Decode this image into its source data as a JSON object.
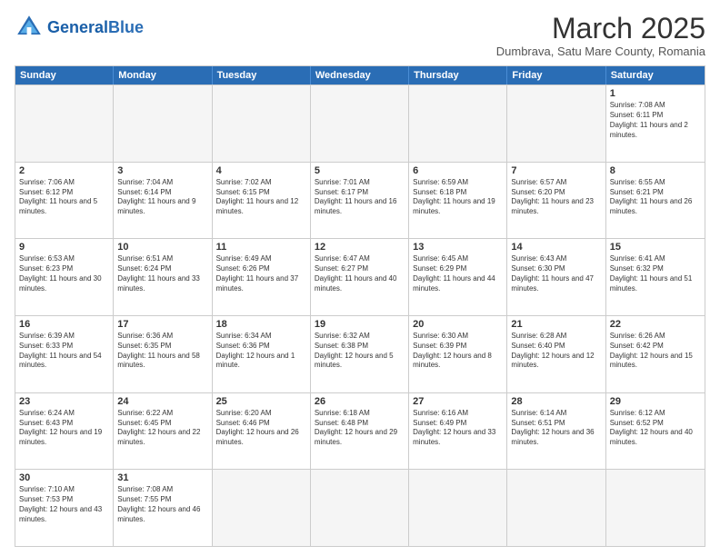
{
  "header": {
    "logo_general": "General",
    "logo_blue": "Blue",
    "month_title": "March 2025",
    "subtitle": "Dumbrava, Satu Mare County, Romania"
  },
  "days": [
    "Sunday",
    "Monday",
    "Tuesday",
    "Wednesday",
    "Thursday",
    "Friday",
    "Saturday"
  ],
  "weeks": [
    [
      {
        "num": "",
        "text": "",
        "empty": true
      },
      {
        "num": "",
        "text": "",
        "empty": true
      },
      {
        "num": "",
        "text": "",
        "empty": true
      },
      {
        "num": "",
        "text": "",
        "empty": true
      },
      {
        "num": "",
        "text": "",
        "empty": true
      },
      {
        "num": "",
        "text": "",
        "empty": true
      },
      {
        "num": "1",
        "text": "Sunrise: 7:08 AM\nSunset: 6:11 PM\nDaylight: 11 hours and 2 minutes."
      }
    ],
    [
      {
        "num": "2",
        "text": "Sunrise: 7:06 AM\nSunset: 6:12 PM\nDaylight: 11 hours and 5 minutes."
      },
      {
        "num": "3",
        "text": "Sunrise: 7:04 AM\nSunset: 6:14 PM\nDaylight: 11 hours and 9 minutes."
      },
      {
        "num": "4",
        "text": "Sunrise: 7:02 AM\nSunset: 6:15 PM\nDaylight: 11 hours and 12 minutes."
      },
      {
        "num": "5",
        "text": "Sunrise: 7:01 AM\nSunset: 6:17 PM\nDaylight: 11 hours and 16 minutes."
      },
      {
        "num": "6",
        "text": "Sunrise: 6:59 AM\nSunset: 6:18 PM\nDaylight: 11 hours and 19 minutes."
      },
      {
        "num": "7",
        "text": "Sunrise: 6:57 AM\nSunset: 6:20 PM\nDaylight: 11 hours and 23 minutes."
      },
      {
        "num": "8",
        "text": "Sunrise: 6:55 AM\nSunset: 6:21 PM\nDaylight: 11 hours and 26 minutes."
      }
    ],
    [
      {
        "num": "9",
        "text": "Sunrise: 6:53 AM\nSunset: 6:23 PM\nDaylight: 11 hours and 30 minutes."
      },
      {
        "num": "10",
        "text": "Sunrise: 6:51 AM\nSunset: 6:24 PM\nDaylight: 11 hours and 33 minutes."
      },
      {
        "num": "11",
        "text": "Sunrise: 6:49 AM\nSunset: 6:26 PM\nDaylight: 11 hours and 37 minutes."
      },
      {
        "num": "12",
        "text": "Sunrise: 6:47 AM\nSunset: 6:27 PM\nDaylight: 11 hours and 40 minutes."
      },
      {
        "num": "13",
        "text": "Sunrise: 6:45 AM\nSunset: 6:29 PM\nDaylight: 11 hours and 44 minutes."
      },
      {
        "num": "14",
        "text": "Sunrise: 6:43 AM\nSunset: 6:30 PM\nDaylight: 11 hours and 47 minutes."
      },
      {
        "num": "15",
        "text": "Sunrise: 6:41 AM\nSunset: 6:32 PM\nDaylight: 11 hours and 51 minutes."
      }
    ],
    [
      {
        "num": "16",
        "text": "Sunrise: 6:39 AM\nSunset: 6:33 PM\nDaylight: 11 hours and 54 minutes."
      },
      {
        "num": "17",
        "text": "Sunrise: 6:36 AM\nSunset: 6:35 PM\nDaylight: 11 hours and 58 minutes."
      },
      {
        "num": "18",
        "text": "Sunrise: 6:34 AM\nSunset: 6:36 PM\nDaylight: 12 hours and 1 minute."
      },
      {
        "num": "19",
        "text": "Sunrise: 6:32 AM\nSunset: 6:38 PM\nDaylight: 12 hours and 5 minutes."
      },
      {
        "num": "20",
        "text": "Sunrise: 6:30 AM\nSunset: 6:39 PM\nDaylight: 12 hours and 8 minutes."
      },
      {
        "num": "21",
        "text": "Sunrise: 6:28 AM\nSunset: 6:40 PM\nDaylight: 12 hours and 12 minutes."
      },
      {
        "num": "22",
        "text": "Sunrise: 6:26 AM\nSunset: 6:42 PM\nDaylight: 12 hours and 15 minutes."
      }
    ],
    [
      {
        "num": "23",
        "text": "Sunrise: 6:24 AM\nSunset: 6:43 PM\nDaylight: 12 hours and 19 minutes."
      },
      {
        "num": "24",
        "text": "Sunrise: 6:22 AM\nSunset: 6:45 PM\nDaylight: 12 hours and 22 minutes."
      },
      {
        "num": "25",
        "text": "Sunrise: 6:20 AM\nSunset: 6:46 PM\nDaylight: 12 hours and 26 minutes."
      },
      {
        "num": "26",
        "text": "Sunrise: 6:18 AM\nSunset: 6:48 PM\nDaylight: 12 hours and 29 minutes."
      },
      {
        "num": "27",
        "text": "Sunrise: 6:16 AM\nSunset: 6:49 PM\nDaylight: 12 hours and 33 minutes."
      },
      {
        "num": "28",
        "text": "Sunrise: 6:14 AM\nSunset: 6:51 PM\nDaylight: 12 hours and 36 minutes."
      },
      {
        "num": "29",
        "text": "Sunrise: 6:12 AM\nSunset: 6:52 PM\nDaylight: 12 hours and 40 minutes."
      }
    ],
    [
      {
        "num": "30",
        "text": "Sunrise: 7:10 AM\nSunset: 7:53 PM\nDaylight: 12 hours and 43 minutes."
      },
      {
        "num": "31",
        "text": "Sunrise: 7:08 AM\nSunset: 7:55 PM\nDaylight: 12 hours and 46 minutes."
      },
      {
        "num": "",
        "text": "",
        "empty": true
      },
      {
        "num": "",
        "text": "",
        "empty": true
      },
      {
        "num": "",
        "text": "",
        "empty": true
      },
      {
        "num": "",
        "text": "",
        "empty": true
      },
      {
        "num": "",
        "text": "",
        "empty": true
      }
    ]
  ]
}
